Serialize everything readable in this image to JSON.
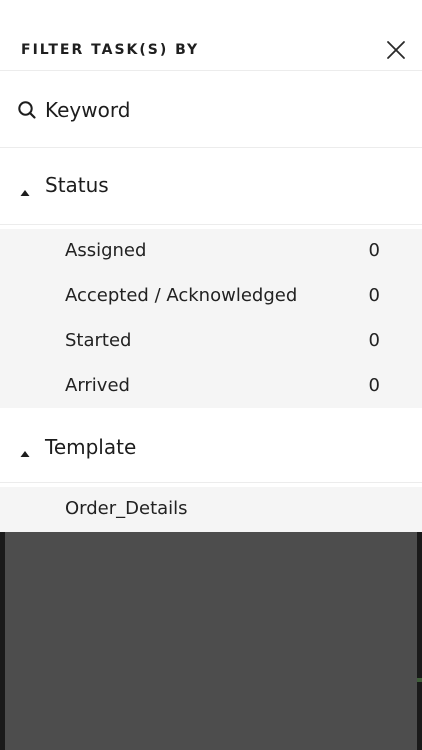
{
  "header": {
    "title": "FILTER TASK(S) BY",
    "close_icon": "close-icon"
  },
  "keyword": {
    "icon": "search-icon",
    "label": "Keyword"
  },
  "status": {
    "label": "Status",
    "expanded": true,
    "options": [
      {
        "label": "Assigned",
        "count": "0"
      },
      {
        "label": "Accepted / Acknowledged",
        "count": "0"
      },
      {
        "label": "Started",
        "count": "0"
      },
      {
        "label": "Arrived",
        "count": "0"
      }
    ]
  },
  "template": {
    "label": "Template",
    "expanded": true,
    "options": [
      {
        "label": "Order_Details"
      }
    ]
  },
  "colors": {
    "background": "#ffffff",
    "list_background": "#f5f5f5",
    "overlay": "#4d4d4d",
    "text": "#1d1d1d"
  }
}
